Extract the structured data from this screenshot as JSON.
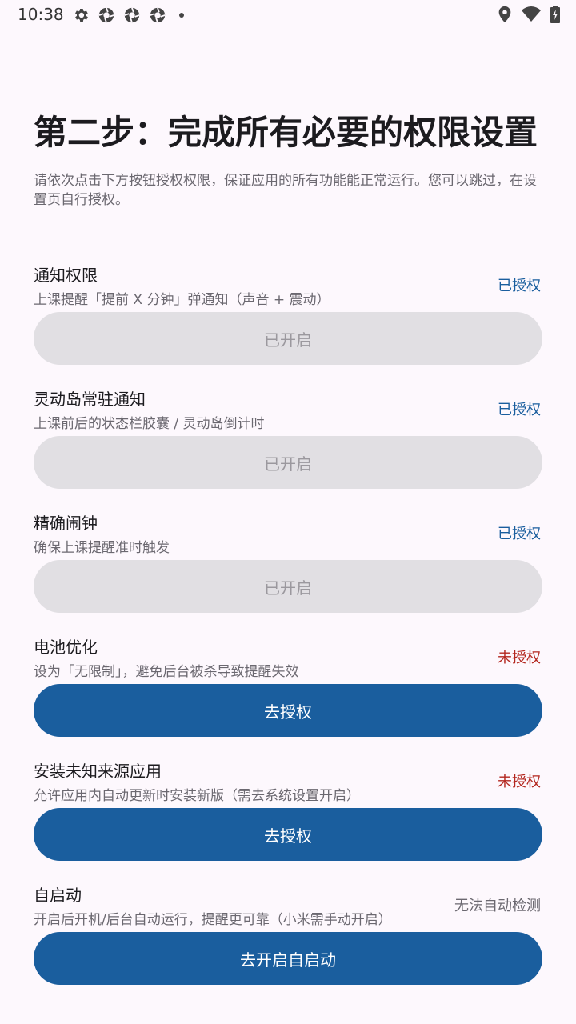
{
  "status_bar": {
    "time": "10:38"
  },
  "header": {
    "title": "第二步：完成所有必要的权限设置",
    "subtitle": "请依次点击下方按钮授权权限，保证应用的所有功能能正常运行。您可以跳过，在设置页自行授权。"
  },
  "permissions": [
    {
      "name": "通知权限",
      "desc": "上课提醒「提前 X 分钟」弹通知（声音 + 震动）",
      "status": "已授权",
      "button": "已开启"
    },
    {
      "name": "灵动岛常驻通知",
      "desc": "上课前后的状态栏胶囊 / 灵动岛倒计时",
      "status": "已授权",
      "button": "已开启"
    },
    {
      "name": "精确闹钟",
      "desc": "确保上课提醒准时触发",
      "status": "已授权",
      "button": "已开启"
    },
    {
      "name": "电池优化",
      "desc": "设为「无限制」，避免后台被杀导致提醒失效",
      "status": "未授权",
      "button": "去授权"
    },
    {
      "name": "安装未知来源应用",
      "desc": "允许应用内自动更新时安装新版（需去系统设置开启）",
      "status": "未授权",
      "button": "去授权"
    },
    {
      "name": "自启动",
      "desc": "开启后开机/后台自动运行，提醒更可靠（小米需手动开启）",
      "status": "无法自动检测",
      "button": "去开启自启动"
    }
  ],
  "colors": {
    "primary": "#1a5e9e",
    "granted": "#1a5e9e",
    "denied": "#b3261e",
    "disabled_bg": "#e1dfe3",
    "background": "#fdf8fd"
  }
}
